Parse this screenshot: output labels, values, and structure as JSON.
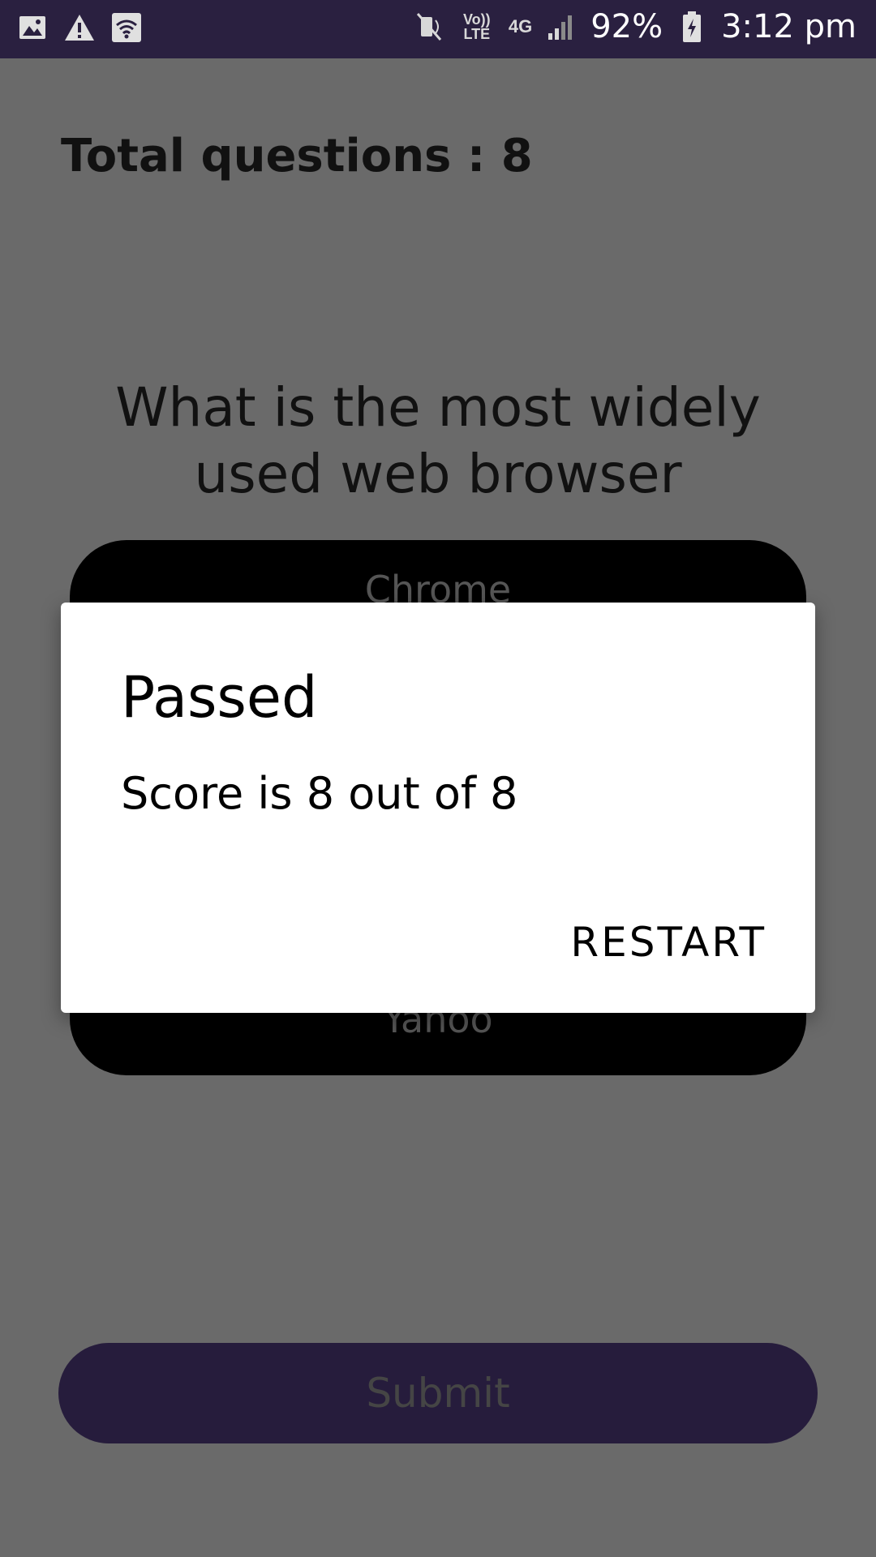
{
  "status_bar": {
    "left_icons": [
      "image-icon",
      "warning-icon",
      "wifi-calling-icon"
    ],
    "volte": "Vo)) LTE",
    "network": "4G",
    "battery_percent": "92%",
    "time": "3:12 pm"
  },
  "quiz": {
    "total_questions": "Total questions : 8",
    "question": "What is the most widely used web browser",
    "options": [
      "Chrome",
      "Yahoo"
    ],
    "submit_label": "Submit"
  },
  "dialog": {
    "title": "Passed",
    "message": "Score is 8 out of 8",
    "button_label": "RESTART"
  },
  "colors": {
    "status_bar_bg": "#2a2040",
    "scrim_bg": "#6a6a6a",
    "option_bg": "#000000",
    "submit_bg": "#261c3c",
    "dialog_bg": "#ffffff"
  }
}
